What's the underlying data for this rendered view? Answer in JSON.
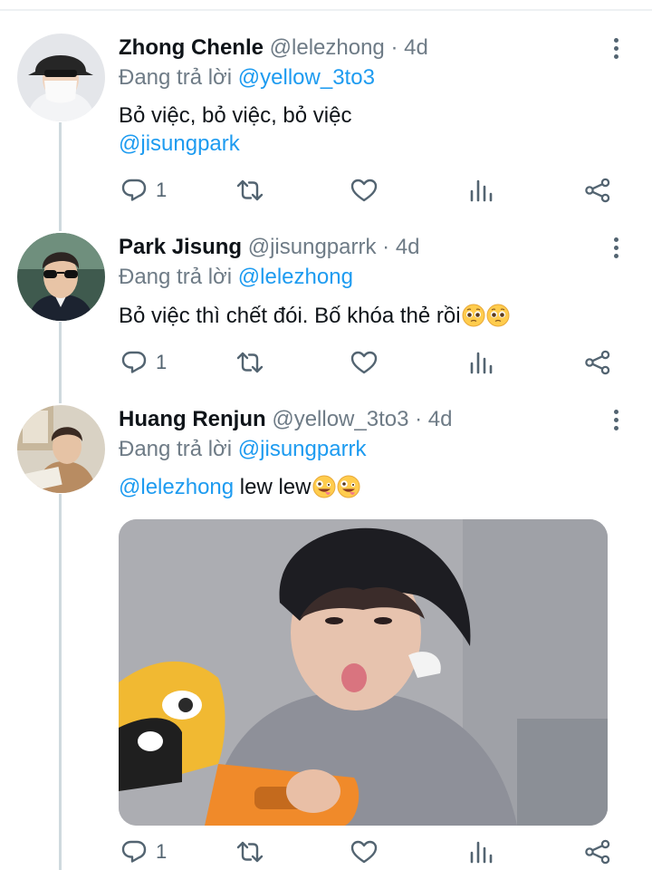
{
  "tweets": [
    {
      "name": "Zhong Chenle",
      "handle": "@lelezhong",
      "time": "4d",
      "replying_prefix": "Đang trả lời",
      "replying_to": "@yellow_3to3",
      "text_line1": "Bỏ việc, bỏ việc, bỏ việc",
      "mention": "@jisungpark",
      "reply_count": "1"
    },
    {
      "name": "Park Jisung",
      "handle": "@jisungparrk",
      "time": "4d",
      "replying_prefix": "Đang trả lời",
      "replying_to": "@lelezhong",
      "text": "Bỏ việc thì chết đói. Bố khóa thẻ rồi",
      "emoji": [
        "pleading-face-emoji",
        "pleading-face-emoji"
      ],
      "reply_count": "1"
    },
    {
      "name": "Huang Renjun",
      "handle": "@yellow_3to3",
      "time": "4d",
      "replying_prefix": "Đang trả lời",
      "replying_to": "@jisungparrk",
      "mention": "@lelezhong",
      "text": "lew lew",
      "emoji": [
        "zany-face-emoji",
        "zany-face-emoji"
      ],
      "reply_count": "1"
    }
  ],
  "separator": "·",
  "icons": [
    "reply-icon",
    "retweet-icon",
    "like-icon",
    "views-icon",
    "share-icon",
    "more-icon"
  ],
  "colors": {
    "link": "#1d9bf0",
    "secondary_text": "#6e7b86",
    "icon": "#536471",
    "thread_line": "#cfd9de"
  }
}
